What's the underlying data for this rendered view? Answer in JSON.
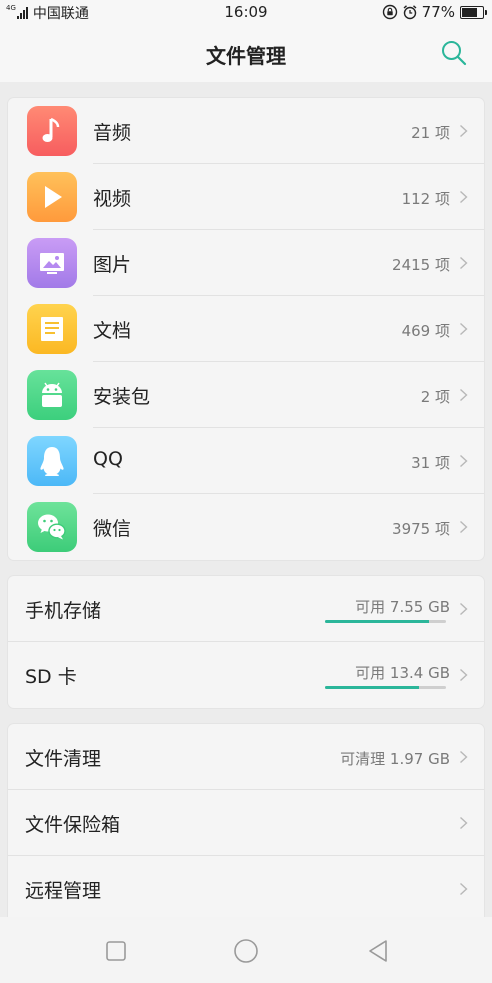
{
  "status_bar": {
    "network": "4G",
    "carrier": "中国联通",
    "time": "16:09",
    "battery_percent": "77%",
    "battery_level": 0.77,
    "icons": [
      "rotation-lock-icon",
      "alarm-icon",
      "battery-icon"
    ]
  },
  "header": {
    "title": "文件管理",
    "search_icon": "search-icon"
  },
  "categories": [
    {
      "label": "音频",
      "count": "21 项",
      "icon": "music-note-icon",
      "color_top": "#ff8a74",
      "color_bottom": "#f75d5f"
    },
    {
      "label": "视频",
      "count": "112 项",
      "icon": "play-icon",
      "color_top": "#ffc15a",
      "color_bottom": "#ff9a3c"
    },
    {
      "label": "图片",
      "count": "2415 项",
      "icon": "picture-icon",
      "color_top": "#c99cf5",
      "color_bottom": "#a27ae8"
    },
    {
      "label": "文档",
      "count": "469 项",
      "icon": "document-icon",
      "color_top": "#ffd34e",
      "color_bottom": "#fbb823"
    },
    {
      "label": "安装包",
      "count": "2 项",
      "icon": "android-icon",
      "color_top": "#67e29a",
      "color_bottom": "#3ccf7d"
    },
    {
      "label": "QQ",
      "count": "31 项",
      "icon": "qq-penguin-icon",
      "color_top": "#7fd6ff",
      "color_bottom": "#4cb8f7"
    },
    {
      "label": "微信",
      "count": "3975 项",
      "icon": "wechat-icon",
      "color_top": "#6ee39a",
      "color_bottom": "#3dcc79"
    }
  ],
  "storage": [
    {
      "label": "手机存储",
      "available": "可用 7.55 GB",
      "used_fraction": 0.86
    },
    {
      "label": "SD 卡",
      "available": "可用 13.4 GB",
      "used_fraction": 0.78
    }
  ],
  "tools": [
    {
      "label": "文件清理",
      "meta": "可清理 1.97 GB"
    },
    {
      "label": "文件保险箱",
      "meta": ""
    },
    {
      "label": "远程管理",
      "meta": ""
    }
  ],
  "colors": {
    "accent": "#2bb69a",
    "text_primary": "#222222",
    "text_secondary": "#7a7a7a"
  },
  "nav_bar": {
    "icons": [
      "recent-apps-icon",
      "home-icon",
      "back-icon"
    ]
  }
}
